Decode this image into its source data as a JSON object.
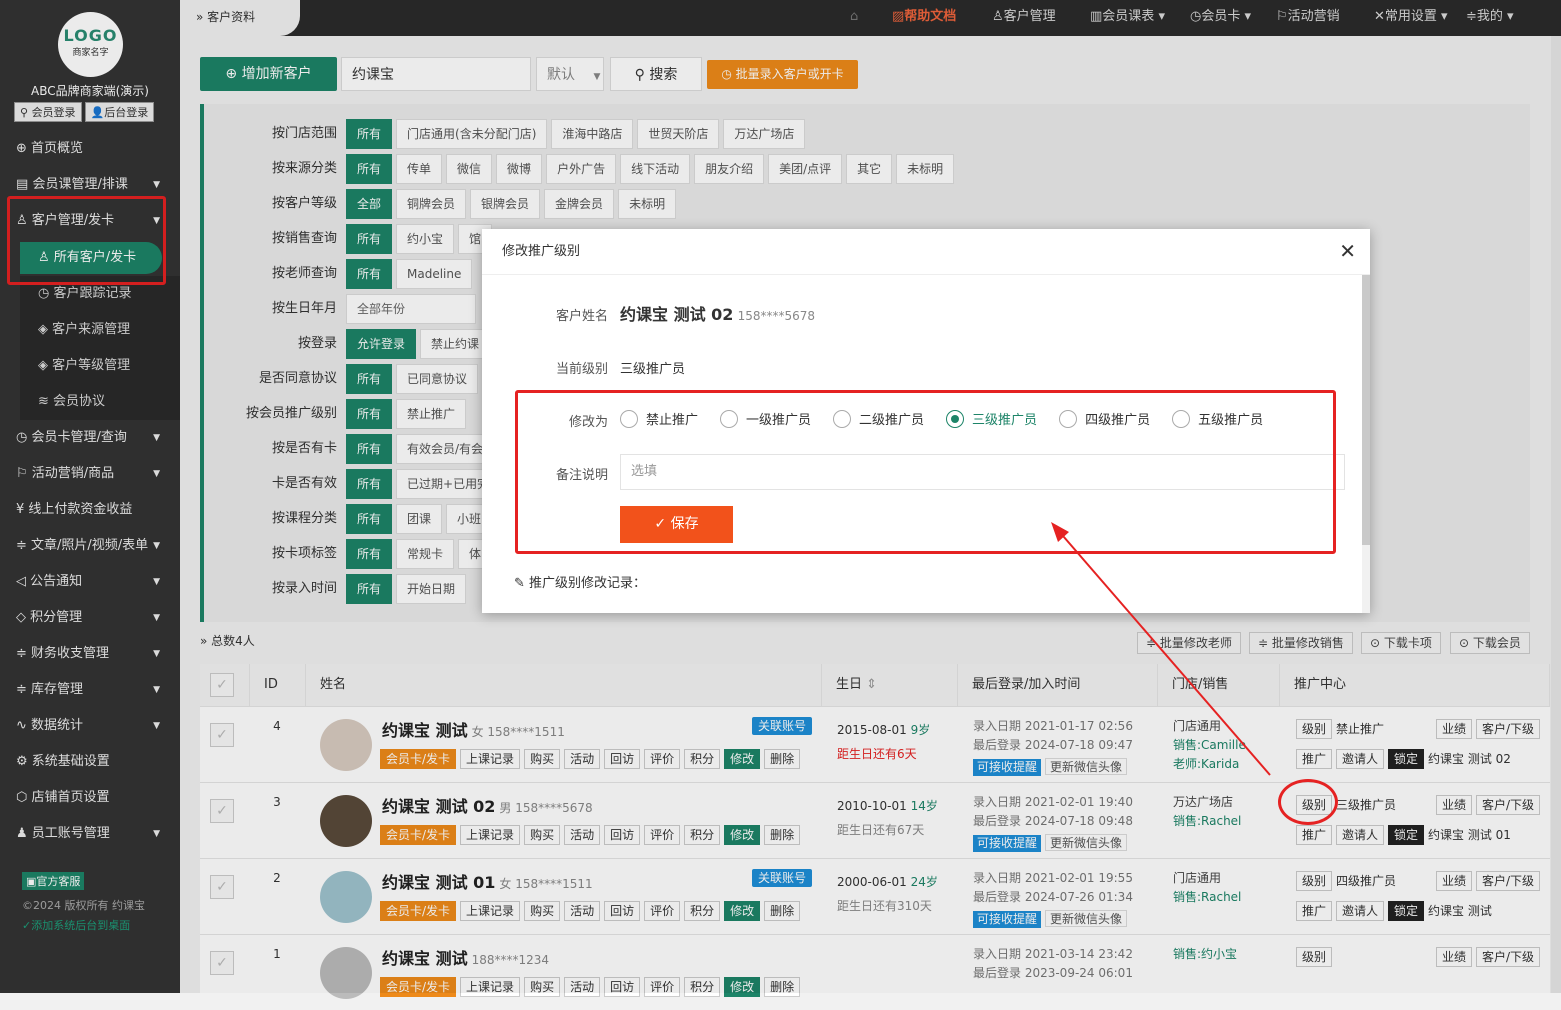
{
  "sidebar": {
    "logo_main": "LOGO",
    "logo_sub": "商家名字",
    "brand": "ABC品牌商家端(演示)",
    "member_login": "会员登录",
    "admin_login": "后台登录",
    "items": [
      {
        "label": "首页概览",
        "icon": "globe-icon"
      },
      {
        "label": "会员课管理/排课",
        "icon": "doc-icon"
      },
      {
        "label": "客户管理/发卡",
        "icon": "user-icon"
      }
    ],
    "sub": [
      "所有客户/发卡",
      "客户跟踪记录",
      "客户来源管理",
      "客户等级管理",
      "会员协议"
    ],
    "items2": [
      "会员卡管理/查询",
      "活动营销/商品",
      "线上付款资金收益",
      "文章/照片/视频/表单",
      "公告通知",
      "积分管理",
      "财务收支管理",
      "库存管理",
      "数据统计",
      "系统基础设置",
      "店铺首页设置",
      "员工账号管理"
    ],
    "service": "官方客服",
    "copyright": "©2024 版权所有 约课宝",
    "add_desktop": "添加系统后台到桌面"
  },
  "topbar": {
    "crumb": "客户资料",
    "nav": [
      "帮助文档",
      "客户管理",
      "会员课表",
      "会员卡",
      "活动营销",
      "常用设置",
      "我的"
    ]
  },
  "toolbar": {
    "add": "增加新客户",
    "search_value": "约课宝",
    "select": "默认",
    "search": "搜索",
    "batch": "批量录入客户或开卡"
  },
  "filters": [
    {
      "label": "按门店范围",
      "opts": [
        "所有",
        "门店通用(含未分配门店)",
        "淮海中路店",
        "世贸天阶店",
        "万达广场店"
      ]
    },
    {
      "label": "按来源分类",
      "opts": [
        "所有",
        "传单",
        "微信",
        "微博",
        "户外广告",
        "线下活动",
        "朋友介绍",
        "美团/点评",
        "其它",
        "未标明"
      ]
    },
    {
      "label": "按客户等级",
      "opts": [
        "全部",
        "铜牌会员",
        "银牌会员",
        "金牌会员",
        "未标明"
      ]
    },
    {
      "label": "按销售查询",
      "opts": [
        "所有",
        "约小宝",
        "馆"
      ]
    },
    {
      "label": "按老师查询",
      "opts": [
        "所有",
        "Madeline"
      ]
    },
    {
      "label": "按生日年月",
      "opts": [
        "全部年份"
      ]
    },
    {
      "label": "按登录",
      "opts": [
        "允许登录",
        "禁止约课"
      ]
    },
    {
      "label": "是否同意协议",
      "opts": [
        "所有",
        "已同意协议"
      ]
    },
    {
      "label": "按会员推广级别",
      "opts": [
        "所有",
        "禁止推广"
      ]
    },
    {
      "label": "按是否有卡",
      "opts": [
        "所有",
        "有效会员/有会"
      ]
    },
    {
      "label": "卡是否有效",
      "opts": [
        "所有",
        "已过期+已用完"
      ]
    },
    {
      "label": "按课程分类",
      "opts": [
        "所有",
        "团课",
        "小班"
      ]
    },
    {
      "label": "按卡项标签",
      "opts": [
        "所有",
        "常规卡",
        "体"
      ]
    },
    {
      "label": "按录入时间",
      "opts": [
        "所有",
        "开始日期"
      ]
    }
  ],
  "list": {
    "total": "总数4人",
    "btns": [
      "批量修改老师",
      "批量修改销售",
      "下载卡项",
      "下载会员"
    ],
    "headers": [
      "ID",
      "姓名",
      "生日",
      "最后登录/加入时间",
      "门店/销售",
      "推广中心"
    ],
    "actions": [
      "会员卡/发卡",
      "上课记录",
      "购买",
      "活动",
      "回访",
      "评价",
      "积分",
      "修改",
      "删除"
    ],
    "rows": [
      {
        "id": "4",
        "name": "约课宝 测试",
        "meta": "女 158****1511",
        "tag": "关联账号",
        "bd": "2015-08-01",
        "age": "9岁",
        "bd2": "距生日还有6天",
        "t1": "录入日期 2021-01-17 02:56",
        "t2": "最后登录 2024-07-18 09:47",
        "s1": "门店通用",
        "s2": "销售:Camille",
        "s3": "老师:Karida",
        "lvl": "禁止推广",
        "ref": "约课宝 测试 02"
      },
      {
        "id": "3",
        "name": "约课宝 测试 02",
        "meta": "男 158****5678",
        "tag": "",
        "bd": "2010-10-01",
        "age": "14岁",
        "bd2": "距生日还有67天",
        "t1": "录入日期 2021-02-01 19:40",
        "t2": "最后登录 2024-07-18 09:48",
        "s1": "万达广场店",
        "s2": "销售:Rachel",
        "s3": "",
        "lvl": "三级推广员",
        "ref": "约课宝 测试 01"
      },
      {
        "id": "2",
        "name": "约课宝 测试 01",
        "meta": "女 158****1511",
        "tag": "关联账号",
        "bd": "2000-06-01",
        "age": "24岁",
        "bd2": "距生日还有310天",
        "t1": "录入日期 2021-02-01 19:55",
        "t2": "最后登录 2024-07-26 01:34",
        "s1": "门店通用",
        "s2": "销售:Rachel",
        "s3": "",
        "lvl": "四级推广员",
        "ref": "约课宝 测试"
      },
      {
        "id": "1",
        "name": "约课宝 测试",
        "meta": "188****1234",
        "tag": "",
        "bd": "",
        "age": "",
        "bd2": "",
        "t1": "录入日期 2021-03-14 23:42",
        "t2": "最后登录 2023-09-24 06:01",
        "s1": "",
        "s2": "销售:约小宝",
        "s3": "",
        "lvl": "",
        "ref": ""
      }
    ],
    "remind": "可接收提醒",
    "update_avatar": "更新微信头像",
    "level_btn": "级别",
    "perf": "业绩",
    "sub_client": "客户/下级",
    "promote": "推广",
    "inviter": "邀请人",
    "lock": "锁定"
  },
  "modal": {
    "title": "修改推广级别",
    "name_label": "客户姓名",
    "name": "约课宝 测试 02",
    "phone": "158****5678",
    "cur_label": "当前级别",
    "cur": "三级推广员",
    "change_label": "修改为",
    "options": [
      "禁止推广",
      "一级推广员",
      "二级推广员",
      "三级推广员",
      "四级推广员",
      "五级推广员"
    ],
    "selected": "三级推广员",
    "note_label": "备注说明",
    "note_placeholder": "选填",
    "save": "保存",
    "record": "推广级别修改记录："
  },
  "colors": {
    "primary": "#1d8468",
    "orange": "#ee8a1a",
    "save": "#f2521b",
    "highlight": "#e52222"
  }
}
